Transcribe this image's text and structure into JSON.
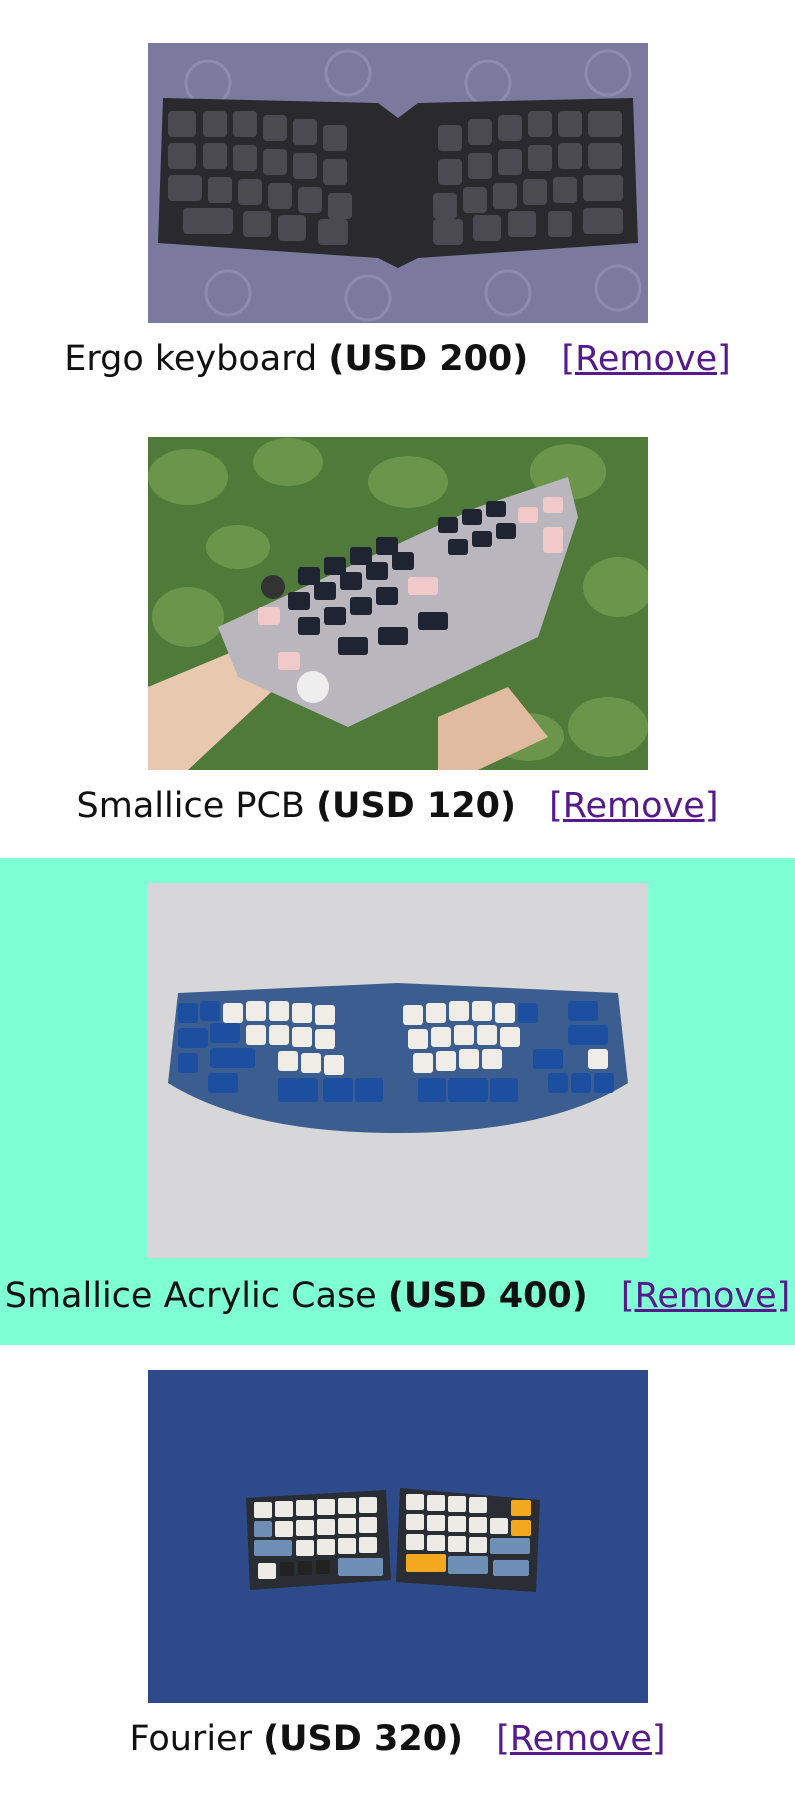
{
  "items": [
    {
      "name": "Ergo keyboard",
      "price": "(USD 200)",
      "remove_label": "[Remove]",
      "highlighted": false
    },
    {
      "name": "Smallice PCB",
      "price": "(USD 120)",
      "remove_label": "[Remove]",
      "highlighted": false
    },
    {
      "name": "Smallice Acrylic Case",
      "price": "(USD 400)",
      "remove_label": "[Remove]",
      "highlighted": true
    },
    {
      "name": "Fourier",
      "price": "(USD 320)",
      "remove_label": "[Remove]",
      "highlighted": false
    }
  ],
  "colors": {
    "highlight_bg": "#7fffd4",
    "link": "#551a8b"
  }
}
